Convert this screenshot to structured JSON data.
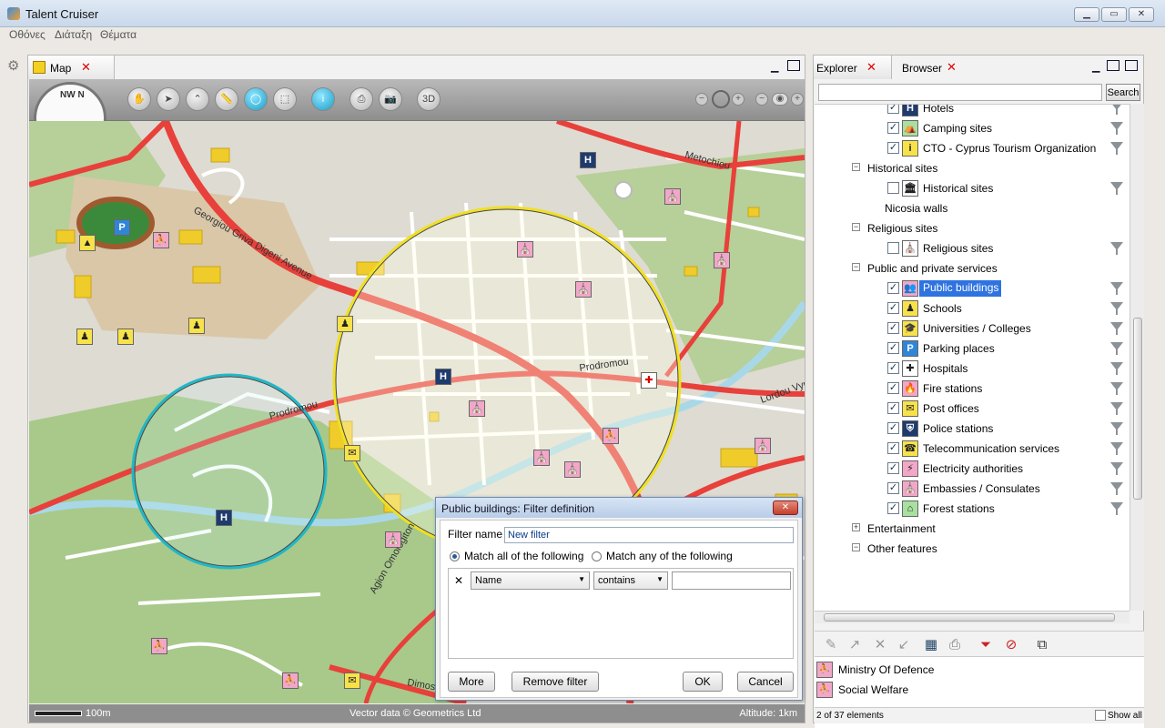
{
  "window": {
    "title": "Talent Cruiser",
    "minimize_symbol": "▁",
    "maximize_symbol": "▭",
    "close_symbol": "✕"
  },
  "menu": [
    "Οθόνες",
    "Διάταξη",
    "Θέματα"
  ],
  "map_panel": {
    "tab_label": "Map",
    "close_symbol": "✕",
    "compass_label": "NW N",
    "tools": [
      {
        "name": "pan-tool",
        "glyph": "✋"
      },
      {
        "name": "select-tool",
        "glyph": "➤"
      },
      {
        "name": "polygon-select-tool",
        "glyph": "⌃"
      },
      {
        "name": "measure-tool",
        "glyph": "📏"
      },
      {
        "name": "circle-select-tool",
        "glyph": "◯"
      },
      {
        "name": "rect-select-tool",
        "glyph": "⬚"
      },
      {
        "name": "info-tool",
        "glyph": "i"
      },
      {
        "name": "print-tool",
        "glyph": "⎙"
      },
      {
        "name": "camera-tool",
        "glyph": "📷"
      },
      {
        "name": "3d-tool",
        "glyph": "3D"
      }
    ],
    "zoom_out_symbol": "−",
    "zoom_in_symbol": "+",
    "map_labels": [
      "Georgiou Griva Digeni Avenue",
      "Metochiou",
      "Prodromou",
      "Prodromou",
      "Agion Omologiton",
      "Dimosthenous",
      "Lordou Vyronos"
    ],
    "status": {
      "scale": "100m",
      "attribution": "Vector data © Geometrics Ltd",
      "altitude": "Altitude: 1km"
    }
  },
  "filter_dialog": {
    "title": "Public buildings: Filter definition",
    "close_symbol": "✕",
    "filter_name_label": "Filter name",
    "filter_name_value": "New filter",
    "match_all_label": "Match all of the following",
    "match_any_label": "Match any of the following",
    "rule": {
      "remove_symbol": "✕",
      "field": "Name",
      "operator": "contains",
      "value": ""
    },
    "buttons": {
      "more": "More",
      "remove_filter": "Remove filter",
      "ok": "OK",
      "cancel": "Cancel"
    }
  },
  "explorer_panel": {
    "tabs": [
      {
        "label": "Explorer"
      },
      {
        "label": "Browser"
      }
    ],
    "search_button": "Search",
    "search_placeholder": "",
    "tree": [
      {
        "type": "layer",
        "label": "Hotels",
        "checked": true,
        "icon": "hotel-icon",
        "glyph": "H",
        "color": "#1e3b6e"
      },
      {
        "type": "layer",
        "label": "Camping sites",
        "checked": true,
        "icon": "camping-icon",
        "glyph": "⛺",
        "color": "#a8e0a0"
      },
      {
        "type": "layer",
        "label": "CTO - Cyprus Tourism Organization",
        "checked": true,
        "icon": "tourism-info-icon",
        "glyph": "i",
        "color": "#f7e24a"
      },
      {
        "type": "group",
        "label": "Historical sites"
      },
      {
        "type": "layer",
        "label": "Historical sites",
        "checked": false,
        "icon": "monument-icon",
        "glyph": "🏛",
        "color": "#ffffff"
      },
      {
        "type": "plain",
        "label": "Nicosia walls"
      },
      {
        "type": "group",
        "label": "Religious sites"
      },
      {
        "type": "layer",
        "label": "Religious sites",
        "checked": false,
        "icon": "church-icon",
        "glyph": "⛪",
        "color": "#ffffff"
      },
      {
        "type": "group",
        "label": "Public and private services"
      },
      {
        "type": "layer",
        "label": "Public buildings",
        "checked": true,
        "selected": true,
        "icon": "public-building-icon",
        "glyph": "👥",
        "color": "#f2a7c8"
      },
      {
        "type": "layer",
        "label": "Schools",
        "checked": true,
        "icon": "school-icon",
        "glyph": "♟",
        "color": "#f7e24a"
      },
      {
        "type": "layer",
        "label": "Universities / Colleges",
        "checked": true,
        "icon": "graduation-cap-icon",
        "glyph": "🎓",
        "color": "#f7e24a"
      },
      {
        "type": "layer",
        "label": "Parking places",
        "checked": true,
        "icon": "parking-icon",
        "glyph": "P",
        "color": "#2f86d6"
      },
      {
        "type": "layer",
        "label": "Hospitals",
        "checked": true,
        "icon": "hospital-cross-icon",
        "glyph": "✚",
        "color": "#ffffff"
      },
      {
        "type": "layer",
        "label": "Fire stations",
        "checked": true,
        "icon": "fire-icon",
        "glyph": "🔥",
        "color": "#f2a7c8"
      },
      {
        "type": "layer",
        "label": "Post offices",
        "checked": true,
        "icon": "envelope-icon",
        "glyph": "✉",
        "color": "#f7e24a"
      },
      {
        "type": "layer",
        "label": "Police stations",
        "checked": true,
        "icon": "police-icon",
        "glyph": "⛨",
        "color": "#1e3b6e"
      },
      {
        "type": "layer",
        "label": "Telecommunication services",
        "checked": true,
        "icon": "phone-icon",
        "glyph": "☎",
        "color": "#f7e24a"
      },
      {
        "type": "layer",
        "label": "Electricity authorities",
        "checked": true,
        "icon": "lightning-icon",
        "glyph": "⚡",
        "color": "#f2a7c8"
      },
      {
        "type": "layer",
        "label": "Embassies / Consulates",
        "checked": true,
        "icon": "embassy-icon",
        "glyph": "⛪",
        "color": "#f2a7c8"
      },
      {
        "type": "layer",
        "label": "Forest stations",
        "checked": true,
        "icon": "forest-house-icon",
        "glyph": "⌂",
        "color": "#a8e0a0"
      },
      {
        "type": "group-collapsed",
        "label": "Entertainment"
      },
      {
        "type": "group",
        "label": "Other features"
      }
    ],
    "results": [
      "Ministry Of Defence",
      "Social Welfare"
    ],
    "element_count": "2 of 37 elements",
    "show_all_label": "Show all"
  },
  "colors": {
    "selection": "#2e73e0",
    "road": "#e8403a",
    "river": "#a8d8e8",
    "park": "#a8c98a",
    "buffer_yellow": "#f0e020",
    "buffer_cyan": "#20b8c8"
  }
}
